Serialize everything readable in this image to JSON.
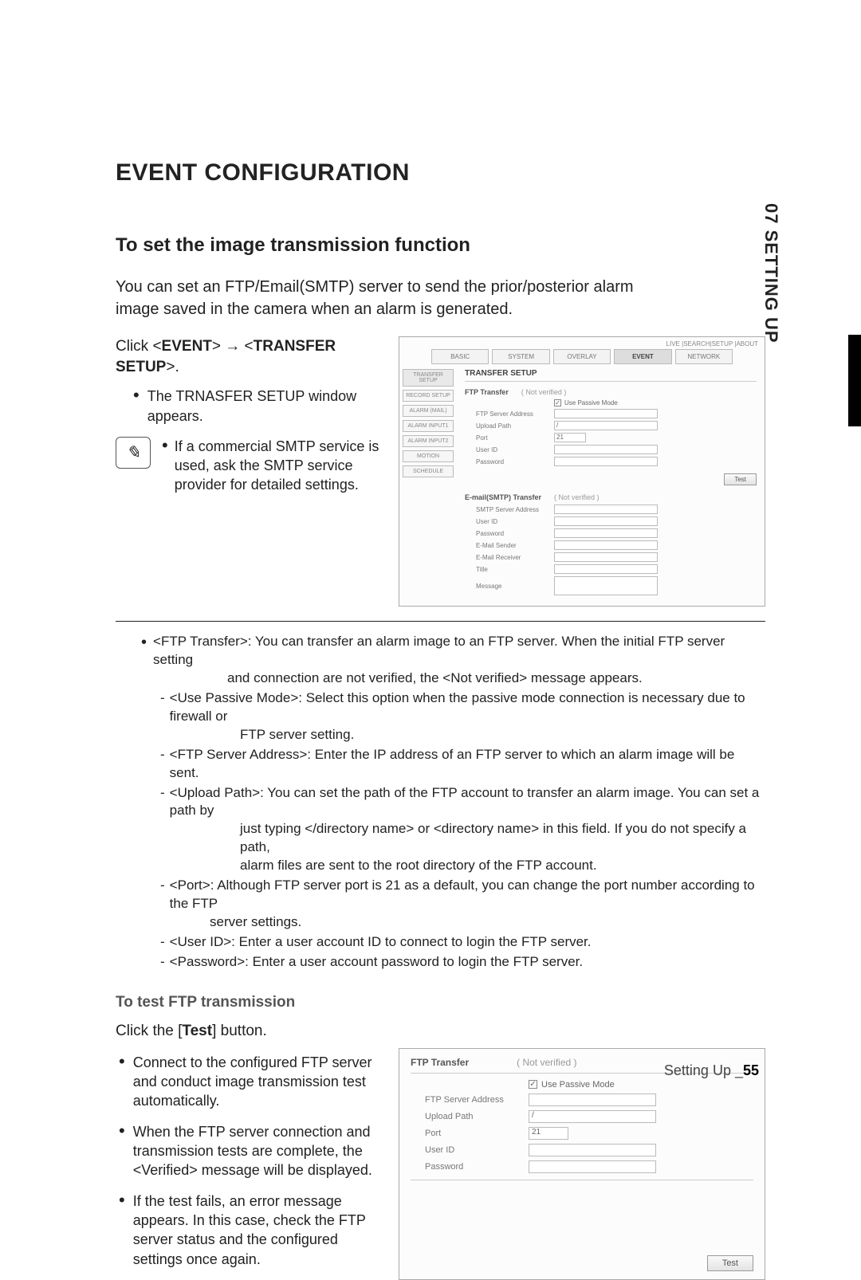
{
  "side_tab": "07 SETTING UP",
  "heading": "EVENT CONFIGURATION",
  "sub_heading": "To set the image transmission function",
  "intro": "You can set an FTP/Email(SMTP) server to send the prior/posterior alarm image saved in the camera when an alarm is generated.",
  "click_prefix": "Click <",
  "click_event": "EVENT",
  "click_mid": "> ",
  "click_arrow": "→",
  "click_mid2": " <",
  "click_transfer": "TRANSFER SETUP",
  "click_suffix": ">.",
  "bullet_appears": "The TRNASFER SETUP window appears.",
  "note_text": "If a commercial SMTP service is used, ask the SMTP service provider for detailed settings.",
  "ui": {
    "breadcrumb": "LIVE |SEARCH|SETUP |ABOUT",
    "tabs": [
      "BASIC",
      "SYSTEM",
      "OVERLAY",
      "EVENT",
      "NETWORK"
    ],
    "active_tab": 3,
    "side": [
      "TRANSFER SETUP",
      "RECORD SETUP",
      "ALARM (MAIL)",
      "ALARM INPUT1",
      "ALARM INPUT2",
      "MOTION",
      "SCHEDULE"
    ],
    "panel_title": "TRANSFER SETUP",
    "ftp": {
      "title": "FTP Transfer",
      "status": "( Not verified )",
      "passive_label": "Use Passive Mode",
      "passive_checked": "✓",
      "rows": {
        "server": "FTP Server Address",
        "upload": "Upload Path",
        "upload_val": "/",
        "port": "Port",
        "port_val": "21",
        "user": "User ID",
        "pass": "Password"
      },
      "test": "Test"
    },
    "smtp": {
      "title": "E-mail(SMTP) Transfer",
      "status": "( Not verified )",
      "rows": {
        "server": "SMTP Server Address",
        "user": "User ID",
        "pass": "Password",
        "sender": "E-Mail Sender",
        "receiver": "E-Mail Receiver",
        "titlef": "Title",
        "msg": "Message"
      }
    }
  },
  "desc": {
    "ftp_transfer": "<FTP Transfer>: You can transfer an alarm image to an FTP server. When the initial FTP server setting",
    "ftp_transfer_cont": "and connection are not verified, the <Not verified> message appears.",
    "passive": "<Use Passive Mode>: Select this option when the passive mode connection is necessary due to firewall or",
    "passive_cont": "FTP server setting.",
    "addr": "<FTP Server Address>: Enter the IP address of an FTP server to which an alarm image will be sent.",
    "upload": "<Upload Path>: You can set the path of the FTP account to transfer an alarm image. You can set a path by",
    "upload_cont1": "just typing </directory name> or <directory name> in this field. If you do not specify a path,",
    "upload_cont2": "alarm files are sent to the root directory of the FTP account.",
    "port": "<Port>: Although FTP server port is 21 as a default, you can change the port number according to the FTP",
    "port_cont": "server settings.",
    "user": "<User ID>: Enter a user account ID to connect to login the FTP server.",
    "pass": "<Password>: Enter a user account password to login the FTP server."
  },
  "test_heading": "To test FTP transmission",
  "click_test_pre": "Click the [",
  "click_test_b": "Test",
  "click_test_post": "] button.",
  "test_b1": "Connect to the configured FTP server and conduct image transmission test automatically.",
  "test_b2": "When the FTP server connection and transmission tests are complete, the <Verified> message will be displayed.",
  "test_b3": "If the test fails, an error message appears. In this case, check the FTP server status and the configured settings once again.",
  "footer_label": "Setting Up _",
  "footer_page": "55"
}
